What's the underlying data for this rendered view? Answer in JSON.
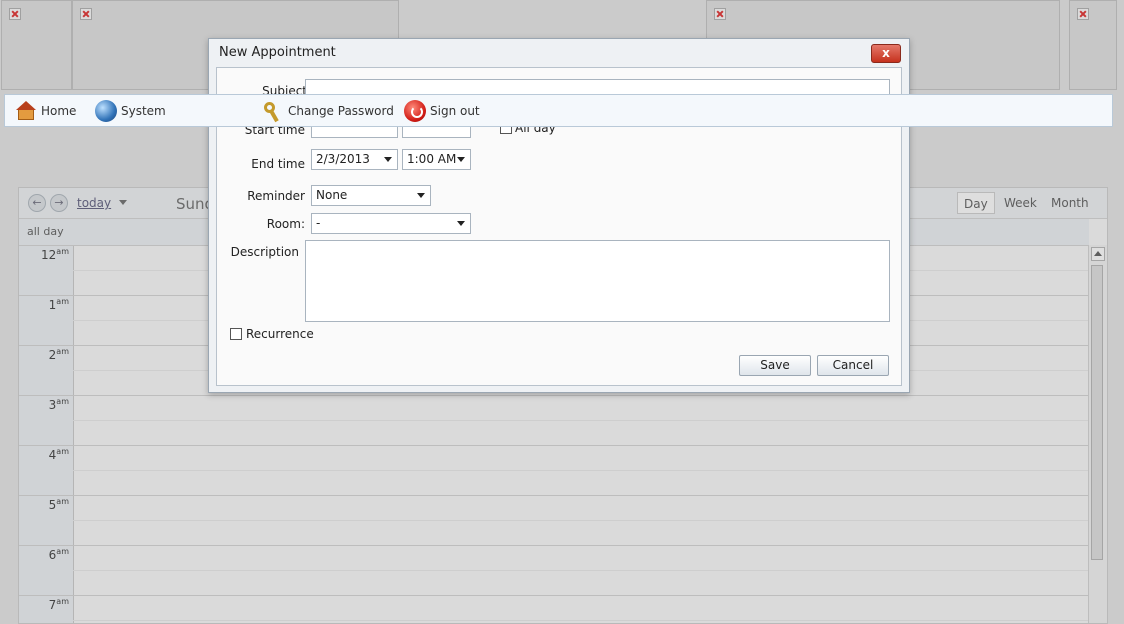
{
  "nav": {
    "home": "Home",
    "system": "System",
    "change_password": "Change Password",
    "sign_out": "Sign out"
  },
  "calendar": {
    "today": "today",
    "date_title": "Sund",
    "all_day": "all day",
    "views": [
      "Day",
      "Week",
      "Month"
    ],
    "hours": [
      {
        "h": "12",
        "ampm": "am"
      },
      {
        "h": "1",
        "ampm": "am"
      },
      {
        "h": "2",
        "ampm": "am"
      },
      {
        "h": "3",
        "ampm": "am"
      },
      {
        "h": "4",
        "ampm": "am"
      },
      {
        "h": "5",
        "ampm": "am"
      },
      {
        "h": "6",
        "ampm": "am"
      },
      {
        "h": "7",
        "ampm": "am"
      }
    ]
  },
  "dialog": {
    "title": "New Appointment",
    "close": "x",
    "subject_label": "Subject",
    "subject_value": "",
    "start_label": "Start time",
    "end_label": "End time",
    "end_date": "2/3/2013",
    "end_time": "1:00 AM",
    "reminder_label": "Reminder",
    "reminder_value": "None",
    "room_label": "Room:",
    "room_value": "-",
    "description_label": "Description",
    "description_value": "",
    "recurrence_label": "Recurrence",
    "allday_label": "All day",
    "save": "Save",
    "cancel": "Cancel"
  }
}
